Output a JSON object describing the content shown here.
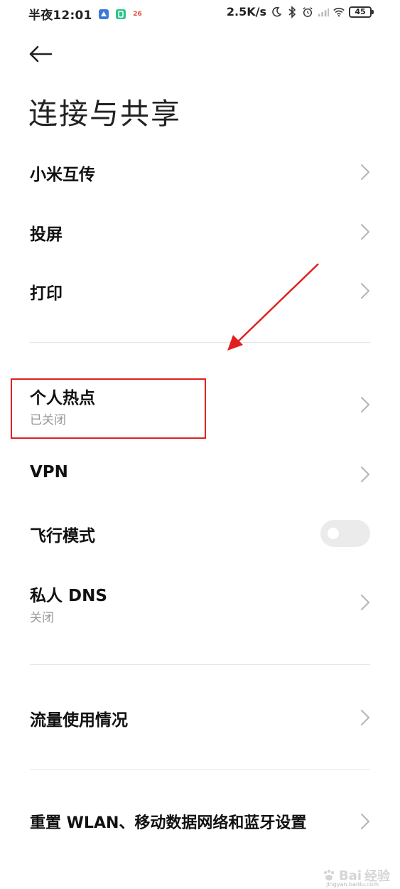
{
  "status_bar": {
    "time": "半夜12:01",
    "notification_badge": "26",
    "network_speed": "2.5K/s",
    "battery": "45"
  },
  "header": {
    "title": "连接与共享"
  },
  "items": [
    {
      "label": "小米互传"
    },
    {
      "label": "投屏"
    },
    {
      "label": "打印"
    },
    {
      "label": "个人热点",
      "sub": "已关闭"
    },
    {
      "label": "VPN"
    },
    {
      "label": "飞行模式",
      "toggle": false
    },
    {
      "label": "私人 DNS",
      "sub": "关闭"
    },
    {
      "label": "流量使用情况"
    },
    {
      "label": "重置 WLAN、移动数据网络和蓝牙设置"
    }
  ],
  "watermark": {
    "brand": "Bai",
    "text": "经验",
    "url": "jingyan.baidu.com"
  },
  "colors": {
    "highlight": "#e02020",
    "subtext": "#999999",
    "toggle_off": "#ebebeb"
  }
}
